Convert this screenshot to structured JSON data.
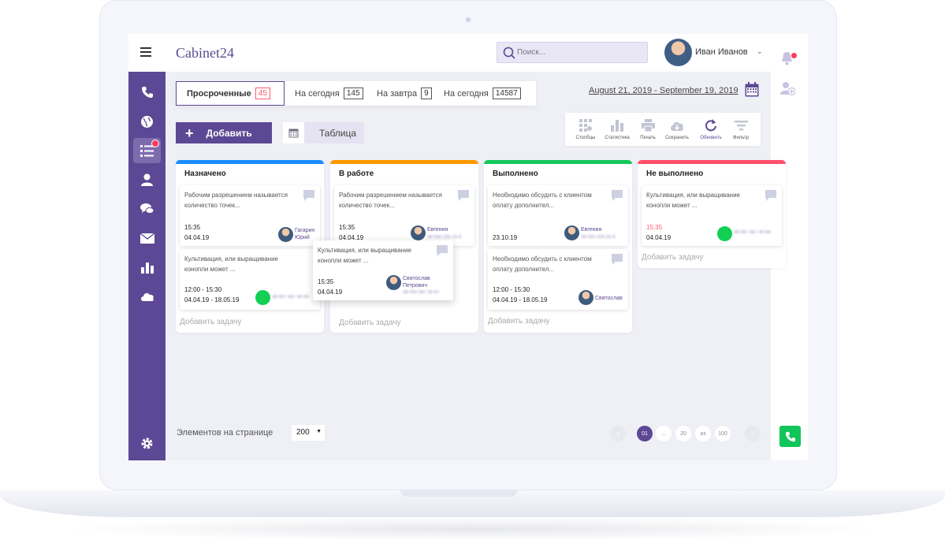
{
  "header": {
    "logo": "Cabinet24",
    "search_placeholder": "Поиск...",
    "user_name": "Иван Иванов"
  },
  "tabs": [
    {
      "label": "Просроченные",
      "count": "45",
      "active": true
    },
    {
      "label": "На сегодня",
      "count": "145"
    },
    {
      "label": "На завтра",
      "count": "9"
    },
    {
      "label": "На сегодня",
      "count": "14587"
    }
  ],
  "date_range": "August 21, 2019 - September 19, 2019",
  "actions": {
    "add_label": "Добавить",
    "view_label": "Таблица"
  },
  "toolbar": [
    {
      "label": "Столбцы",
      "icon": "columns-icon"
    },
    {
      "label": "Статистика",
      "icon": "stats-icon"
    },
    {
      "label": "Печать",
      "icon": "print-icon"
    },
    {
      "label": "Сохранить",
      "icon": "cloud-download-icon"
    },
    {
      "label": "Обновить",
      "icon": "refresh-icon"
    },
    {
      "label": "Фильтр",
      "icon": "filter-icon"
    }
  ],
  "add_task_label": "Добавить задачу",
  "columns": [
    {
      "title": "Назначено",
      "color": "#1a8cff",
      "cards": [
        {
          "text": "Рабочим разрешением называется количество точек...",
          "time": "15:35",
          "date": "04.04.19",
          "assignee": "Гагарин Юрий"
        },
        {
          "text": "Культивация, или выращивание конопли может ...",
          "time": "12:00 - 15:30",
          "date": "04.04.19 - 18.05.19",
          "phone": "38 097 487 44 94"
        }
      ]
    },
    {
      "title": "В работе",
      "color": "#ff9800",
      "cards": [
        {
          "text": "Рабочим разрешением называется количество точек...",
          "time": "15:35",
          "date": "04.04.19",
          "assignee": "Евгения",
          "phone": "38 050 255 25 4"
        }
      ]
    },
    {
      "title": "Выполнено",
      "color": "#16c75a",
      "cards": [
        {
          "text": "Необходимо обсудить с клиентом оплату дополнител...",
          "time": "",
          "date": "23.10.19",
          "assignee": "Евгения",
          "phone": "38 050 254 25 4"
        },
        {
          "text": "Необходимо обсудить с клиентом оплату дополнител...",
          "time": "12:00 - 15:30",
          "date": "04.04.19 - 18.05.19",
          "assignee": "Святослав"
        }
      ]
    },
    {
      "title": "Не выполнено",
      "color": "#ff4f6d",
      "cards": [
        {
          "text": "Культивация, или выращивание конопли может ...",
          "time": "15:35",
          "date": "04.04.19",
          "phone": "38 097 487 44 94"
        }
      ]
    }
  ],
  "drag_card": {
    "text": "Культивация, или выращивание конопли может ...",
    "time": "15:35",
    "date": "04.04.19",
    "assignee": "Святослав Петрович",
    "phone": "38 050 087 55 87"
  },
  "pagination": {
    "per_page_label": "Элементов на странице",
    "per_page_value": "200",
    "current": "01",
    "ellipsis": "...",
    "page_20": "20",
    "of_label": "из",
    "total": "100"
  },
  "colors": {
    "brand": "#5c4894",
    "alert": "#ff3b5c",
    "call": "#12c55a"
  }
}
